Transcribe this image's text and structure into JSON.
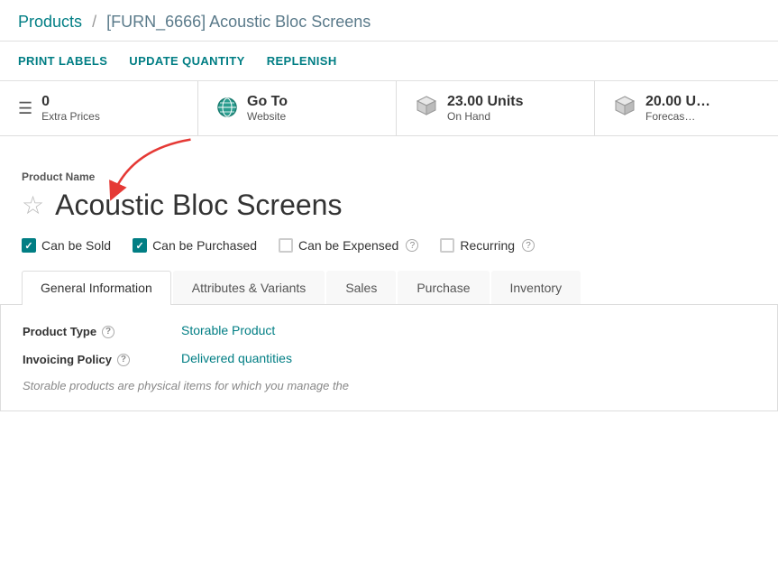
{
  "breadcrumb": {
    "parent": "Products",
    "separator": "/",
    "current": "[FURN_6666] Acoustic Bloc Screens"
  },
  "toolbar": {
    "buttons": [
      {
        "id": "print-labels",
        "label": "PRINT LABELS"
      },
      {
        "id": "update-quantity",
        "label": "UPDATE QUANTITY"
      },
      {
        "id": "replenish",
        "label": "REPLENISH"
      }
    ]
  },
  "stats": [
    {
      "id": "extra-prices",
      "number": "0",
      "label": "Extra Prices",
      "icon": "list"
    },
    {
      "id": "go-to-website",
      "number": "Go To",
      "label": "Website",
      "icon": "globe"
    },
    {
      "id": "units-on-hand",
      "number": "23.00 Units",
      "label": "On Hand",
      "icon": "cube"
    },
    {
      "id": "forecast",
      "number": "20.00 U",
      "label": "Forecas…",
      "icon": "cube"
    }
  ],
  "product": {
    "name_label": "Product Name",
    "title": "Acoustic Bloc Screens",
    "checkboxes": [
      {
        "id": "can-be-sold",
        "label": "Can be Sold",
        "checked": true,
        "has_help": false
      },
      {
        "id": "can-be-purchased",
        "label": "Can be Purchased",
        "checked": true,
        "has_help": false
      },
      {
        "id": "can-be-expensed",
        "label": "Can be Expensed",
        "checked": false,
        "has_help": true
      },
      {
        "id": "recurring",
        "label": "Recurring",
        "checked": false,
        "has_help": true
      }
    ]
  },
  "tabs": [
    {
      "id": "general-information",
      "label": "General Information",
      "active": true
    },
    {
      "id": "attributes-variants",
      "label": "Attributes & Variants",
      "active": false
    },
    {
      "id": "sales",
      "label": "Sales",
      "active": false
    },
    {
      "id": "purchase",
      "label": "Purchase",
      "active": false
    },
    {
      "id": "inventory",
      "label": "Inventory",
      "active": false
    }
  ],
  "general_info": {
    "product_type_label": "Product Type",
    "product_type_value": "Storable Product",
    "invoicing_policy_label": "Invoicing Policy",
    "invoicing_policy_value": "Delivered quantities",
    "note": "Storable products are physical items for which you manage the"
  },
  "arrow": {
    "visible": true
  }
}
